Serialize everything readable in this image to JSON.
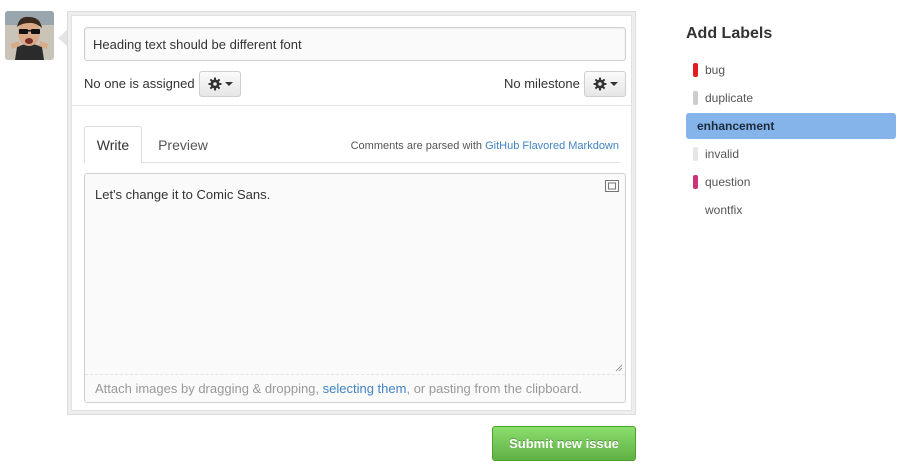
{
  "issue": {
    "title_value": "Heading text should be different font",
    "assignee_text": "No one is assigned",
    "milestone_text": "No milestone",
    "tabs": [
      {
        "label": "Write",
        "active": true
      },
      {
        "label": "Preview",
        "active": false
      }
    ],
    "markdown_note": {
      "prefix": "Comments are parsed with",
      "link": "GitHub Flavored Markdown"
    },
    "body_text": "Let's change it to Comic Sans.",
    "attach_hint": {
      "before": "Attach images by dragging & dropping, ",
      "link": "selecting them",
      "after": ", or pasting from the clipboard."
    },
    "submit_label": "Submit new issue"
  },
  "labels": {
    "heading": "Add Labels",
    "items": [
      {
        "name": "bug",
        "color": "#e11d21",
        "selected": false
      },
      {
        "name": "duplicate",
        "color": "#cccccc",
        "selected": false
      },
      {
        "name": "enhancement",
        "color": "#84b6eb",
        "selected": true
      },
      {
        "name": "invalid",
        "color": "#e6e6e6",
        "selected": false
      },
      {
        "name": "question",
        "color": "#cc317c",
        "selected": false
      },
      {
        "name": "wontfix",
        "color": "#ffffff",
        "selected": false
      }
    ]
  },
  "colors": {
    "accent_link": "#4183c4",
    "submit_green": "#60b044",
    "selected_label_bg": "#84b4e9"
  },
  "icons": {
    "gear": "gear-icon",
    "fullscreen": "fullscreen-icon",
    "resize": "resize-grip-icon"
  }
}
